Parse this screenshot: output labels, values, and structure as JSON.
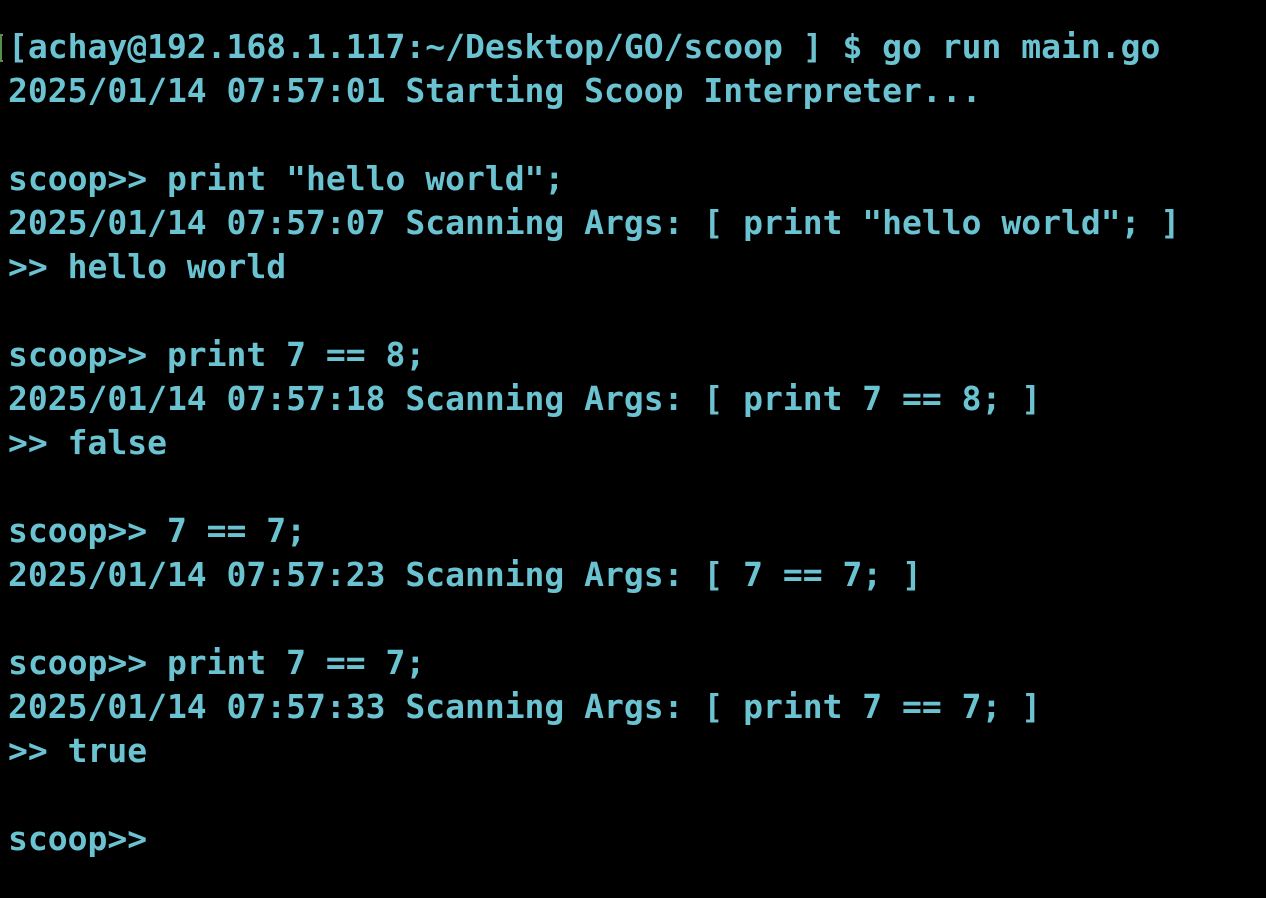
{
  "terminal": {
    "text_color": "#6bc3d1",
    "background": "#000000",
    "lines": [
      "[achay@192.168.1.117:~/Desktop/GO/scoop ] $ go run main.go",
      "2025/01/14 07:57:01 Starting Scoop Interpreter...",
      "",
      "scoop>> print \"hello world\";",
      "2025/01/14 07:57:07 Scanning Args: [ print \"hello world\"; ]",
      ">> hello world",
      "",
      "scoop>> print 7 == 8;",
      "2025/01/14 07:57:18 Scanning Args: [ print 7 == 8; ]",
      ">> false",
      "",
      "scoop>> 7 == 7;",
      "2025/01/14 07:57:23 Scanning Args: [ 7 == 7; ]",
      "",
      "scoop>> print 7 == 7;",
      "2025/01/14 07:57:33 Scanning Args: [ print 7 == 7; ]",
      ">> true",
      "",
      "scoop>> "
    ]
  }
}
